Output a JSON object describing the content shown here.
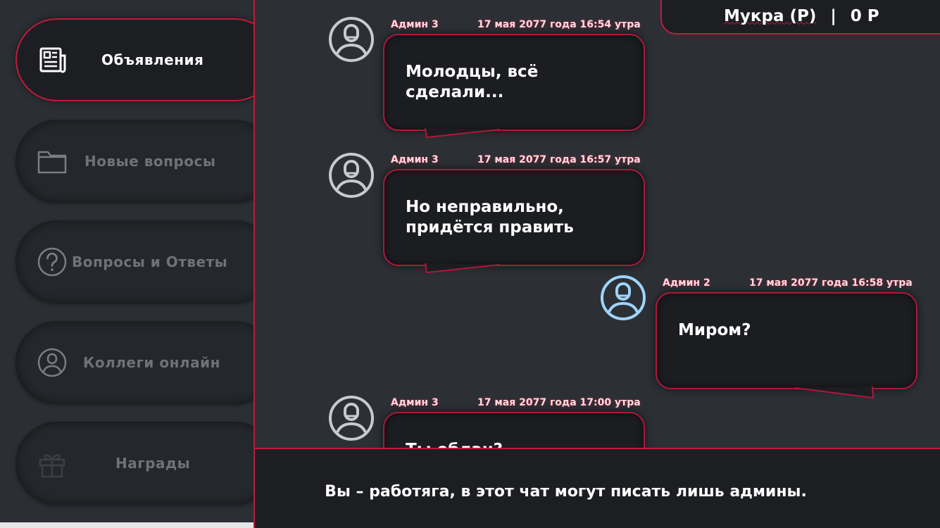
{
  "sidebar": {
    "items": [
      {
        "label": "Объявления",
        "icon": "newspaper-icon",
        "active": true
      },
      {
        "label": "Новые вопросы",
        "icon": "folder-icon",
        "active": false
      },
      {
        "label": "Вопросы и Ответы",
        "icon": "question-circle-icon",
        "active": false
      },
      {
        "label": "Коллеги онлайн",
        "icon": "user-circle-icon",
        "active": false
      },
      {
        "label": "Награды",
        "icon": "gift-icon",
        "active": false
      }
    ]
  },
  "header": {
    "username": "Мукра (Р)",
    "separator": "|",
    "balance": "0 Р"
  },
  "chat": {
    "messages": [
      {
        "author": "Админ 3",
        "time": "17 мая 2077 года 16:54 утра",
        "text": "Молодцы, всё сделали...",
        "side": "left"
      },
      {
        "author": "Админ 3",
        "time": "17 мая 2077 года 16:57 утра",
        "text": "Но неправильно, придётся править",
        "side": "left"
      },
      {
        "author": "Админ 2",
        "time": "17 мая 2077 года 16:58 утра",
        "text": "Миром?",
        "side": "right"
      },
      {
        "author": "Админ 3",
        "time": "17 мая 2077 года 17:00 утра",
        "text": "Ты облан?",
        "side": "left"
      }
    ]
  },
  "footer": {
    "notice": "Вы – работяга, в этот чат могут писать лишь админы."
  },
  "colors": {
    "accent": "#c01a3c",
    "avatar_default": "#c7cad1",
    "avatar_self": "#9fd4ff",
    "bubble_bg": "#1c1d21",
    "sidebar_bg": "#2b2f33",
    "main_bg": "#2c3035"
  }
}
